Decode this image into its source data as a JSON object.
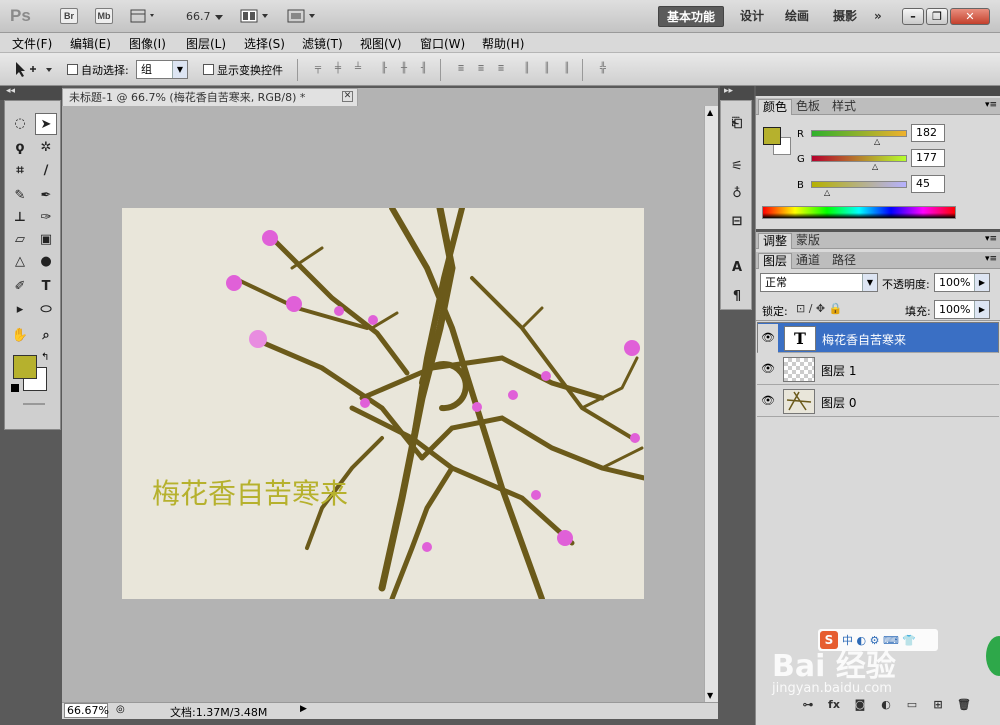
{
  "app": {
    "logo": "Ps",
    "br": "Br",
    "mb": "Mb",
    "zoom": "66.7"
  },
  "workspaces": [
    "基本功能",
    "设计",
    "绘画",
    "摄影",
    "»"
  ],
  "menu": [
    "文件(F)",
    "编辑(E)",
    "图像(I)",
    "图层(L)",
    "选择(S)",
    "滤镜(T)",
    "视图(V)",
    "窗口(W)",
    "帮助(H)"
  ],
  "options": {
    "auto_select_label": "自动选择:",
    "group_value": "组",
    "transform_label": "显示变换控件"
  },
  "document": {
    "tab_title": "未标题-1 @ 66.7% (梅花香自苦寒来, RGB/8) *",
    "canvas_text": "梅花香自苦寒来",
    "zoom_status": "66.67%",
    "doc_size": "文档:1.37M/3.48M"
  },
  "color_panel": {
    "tabs": [
      "颜色",
      "色板",
      "样式"
    ],
    "channels": [
      {
        "label": "R",
        "value": "182",
        "level": 0.71
      },
      {
        "label": "G",
        "value": "177",
        "level": 0.69
      },
      {
        "label": "B",
        "value": "45",
        "level": 0.18
      }
    ],
    "foreground": "#b6b12d"
  },
  "adjust_panel": {
    "tabs": [
      "调整",
      "蒙版"
    ]
  },
  "layers_panel": {
    "tabs": [
      "图层",
      "通道",
      "路径"
    ],
    "blend_mode": "正常",
    "opacity_label": "不透明度:",
    "opacity": "100%",
    "lock_label": "锁定:",
    "fill_label": "填充:",
    "fill": "100%",
    "layers": [
      {
        "name": "梅花香自苦寒来",
        "type": "text",
        "selected": true
      },
      {
        "name": "图层 1",
        "type": "transparent",
        "selected": false
      },
      {
        "name": "图层 0",
        "type": "image",
        "selected": false
      }
    ]
  },
  "watermark": {
    "brand": "Bai 经验",
    "url": "jingyan.baidu.com"
  },
  "colors": {
    "branch": "#6b5a1a",
    "blossom": "#e060d8",
    "canvas": "#e9e6da",
    "selection": "#3a6fc4"
  }
}
